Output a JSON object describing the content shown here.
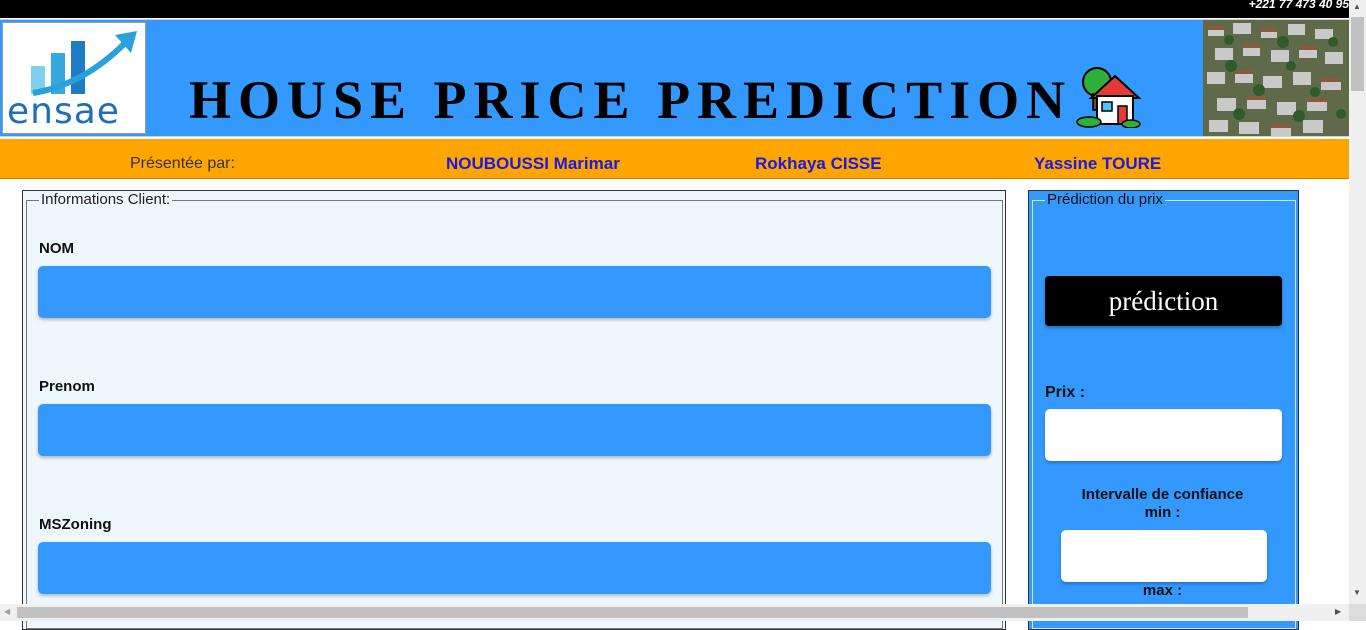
{
  "header": {
    "phone": "+221 77 473 40 95",
    "logo_text": "ensae",
    "title": "HOUSE PRICE PREDICTION",
    "house_icon": "house-icon"
  },
  "presenters": {
    "label": "Présentée par:",
    "names": [
      "NOUBOUSSI Marimar",
      "Rokhaya CISSE",
      "Yassine TOURE"
    ]
  },
  "client_form": {
    "legend": "Informations Client:",
    "fields": [
      {
        "label": "NOM",
        "value": ""
      },
      {
        "label": "Prenom",
        "value": ""
      },
      {
        "label": "MSZoning",
        "value": ""
      }
    ]
  },
  "prediction": {
    "legend": "Prédiction du prix",
    "button_label": "prédiction",
    "prix_label": "Prix :",
    "ic_label": "Intervalle de confiance",
    "min_label": "min :",
    "max_label": "max :",
    "prix_value": "",
    "min_value": ""
  },
  "colors": {
    "banner_blue": "#3399ff",
    "presenters_orange": "#ffa500",
    "presenter_name": "#1a1ae0",
    "form_bg": "#eef7fb"
  }
}
